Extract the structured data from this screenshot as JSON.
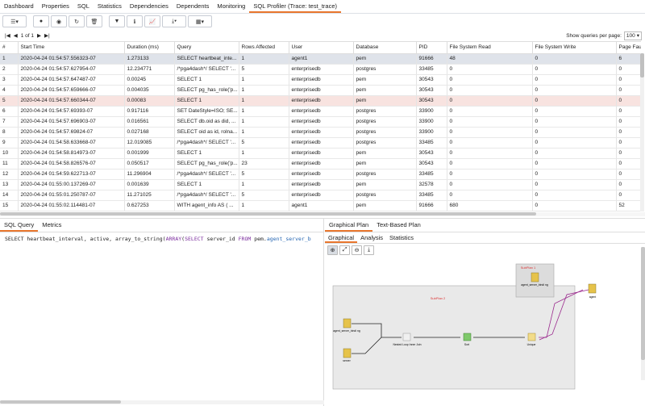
{
  "tabs": [
    "Dashboard",
    "Properties",
    "SQL",
    "Statistics",
    "Dependencies",
    "Dependents",
    "Monitoring",
    "SQL Profiler (Trace: test_trace)"
  ],
  "active_tab_index": 7,
  "toolbar": {
    "columns_icon": "columns-icon",
    "buttons": [
      "start-icon",
      "stop-icon",
      "refresh-icon",
      "delete-icon",
      "filter-icon",
      "info-icon",
      "chart-icon",
      "download-icon",
      "grid-icon"
    ]
  },
  "pager": {
    "page_text": "1 of 1",
    "show_label": "Show queries per page:",
    "per_page": "100"
  },
  "columns": [
    "#",
    "Start Time",
    "Duration (ms)",
    "Query",
    "Rows Affected",
    "User",
    "Database",
    "PID",
    "File System Read",
    "File System Write",
    "Page Faults"
  ],
  "rows": [
    [
      "1",
      "2020-04-24 01:54:57.556323-07",
      "1.273133",
      "SELECT heartbeat_inte...",
      "1",
      "agent1",
      "pem",
      "91666",
      "48",
      "0",
      "6"
    ],
    [
      "2",
      "2020-04-24 01:54:57.627954-07",
      "12.234771",
      "/*pga4dash*/ SELECT '...",
      "5",
      "enterprisedb",
      "postgres",
      "33485",
      "0",
      "0",
      "0"
    ],
    [
      "3",
      "2020-04-24 01:54:57.647487-07",
      "0.00245",
      "SELECT 1",
      "1",
      "enterprisedb",
      "pem",
      "30543",
      "0",
      "0",
      "0"
    ],
    [
      "4",
      "2020-04-24 01:54:57.659666-07",
      "0.004035",
      "SELECT pg_has_role('p...",
      "1",
      "enterprisedb",
      "pem",
      "30543",
      "0",
      "0",
      "0"
    ],
    [
      "5",
      "2020-04-24 01:54:57.660344-07",
      "0.00083",
      "SELECT 1",
      "1",
      "enterprisedb",
      "pem",
      "30543",
      "0",
      "0",
      "0"
    ],
    [
      "6",
      "2020-04-24 01:54:57.69393-07",
      "0.917116",
      "SET DateStyle=ISO; SE...",
      "1",
      "enterprisedb",
      "postgres",
      "33900",
      "0",
      "0",
      "0"
    ],
    [
      "7",
      "2020-04-24 01:54:57.696903-07",
      "0.016561",
      "SELECT db.oid as did, ...",
      "1",
      "enterprisedb",
      "postgres",
      "33900",
      "0",
      "0",
      "0"
    ],
    [
      "8",
      "2020-04-24 01:54:57.69824-07",
      "0.027168",
      "SELECT oid as id, rolna...",
      "1",
      "enterprisedb",
      "postgres",
      "33900",
      "0",
      "0",
      "0"
    ],
    [
      "9",
      "2020-04-24 01:54:58.633668-07",
      "12.019085",
      "/*pga4dash*/ SELECT '...",
      "5",
      "enterprisedb",
      "postgres",
      "33485",
      "0",
      "0",
      "0"
    ],
    [
      "10",
      "2020-04-24 01:54:58.814973-07",
      "0.001999",
      "SELECT 1",
      "1",
      "enterprisedb",
      "pem",
      "30543",
      "0",
      "0",
      "0"
    ],
    [
      "11",
      "2020-04-24 01:54:58.826576-07",
      "0.050517",
      "SELECT pg_has_role('p...",
      "23",
      "enterprisedb",
      "pem",
      "30543",
      "0",
      "0",
      "0"
    ],
    [
      "12",
      "2020-04-24 01:54:59.622713-07",
      "11.296904",
      "/*pga4dash*/ SELECT '...",
      "5",
      "enterprisedb",
      "postgres",
      "33485",
      "0",
      "0",
      "0"
    ],
    [
      "13",
      "2020-04-24 01:55:00.137269-07",
      "0.001639",
      "SELECT 1",
      "1",
      "enterprisedb",
      "pem",
      "32578",
      "0",
      "0",
      "0"
    ],
    [
      "14",
      "2020-04-24 01:55:01.250787-07",
      "11.271025",
      "/*pga4dash*/ SELECT '...",
      "5",
      "enterprisedb",
      "postgres",
      "33485",
      "0",
      "0",
      "0"
    ],
    [
      "15",
      "2020-04-24 01:55:02.114481-07",
      "0.627253",
      "WITH agent_info AS ( ...",
      "1",
      "agent1",
      "pem",
      "91666",
      "680",
      "0",
      "52"
    ]
  ],
  "selected_row_index": 0,
  "highlighted_row_index": 4,
  "left_tabs": [
    "SQL Query",
    "Metrics"
  ],
  "sql": {
    "p1": "SELECT heartbeat_interval, active, array_to_string(",
    "kw_array": "ARRAY",
    "p2": "(",
    "kw_select": "SELECT",
    "p3": " server_id ",
    "kw_from": "FROM",
    "p4": " pem.",
    "ident": "agent_server_b"
  },
  "right_tabs": [
    "Graphical Plan",
    "Text-Based Plan"
  ],
  "right_subtabs": [
    "Graphical",
    "Analysis",
    "Statistics"
  ],
  "plan_tools": [
    "zoom-in-icon",
    "zoom-fit-icon",
    "zoom-out-icon",
    "download-icon"
  ],
  "plan": {
    "subplan1": "SubPlan 1",
    "subplan2": "SubPlan 2",
    "node_scan_top": "agent_server_bindi ng",
    "node_agent": "agent",
    "node_scan_left": "agent_server_bindi ng",
    "node_server": "server",
    "node_nested": "Nested Loop Inner Join",
    "node_sort": "Sort",
    "node_unique": "Unique"
  }
}
